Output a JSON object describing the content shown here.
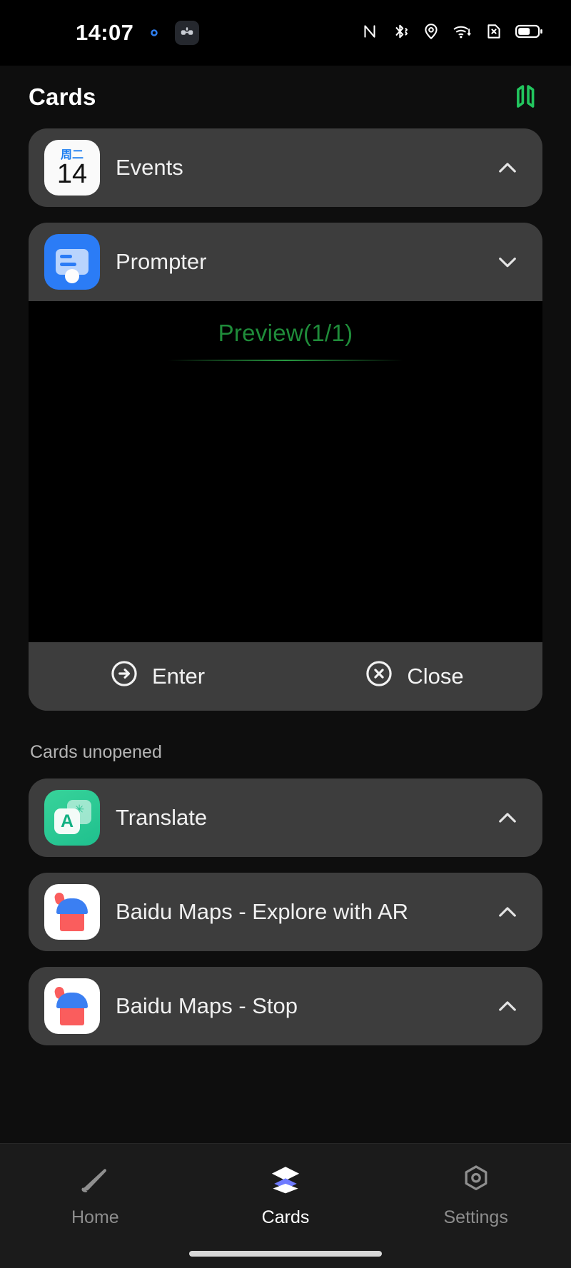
{
  "status_bar": {
    "time": "14:07",
    "left_icons": [
      "settings-gear-icon",
      "glasses-icon"
    ],
    "right_icons": [
      "nfc-icon",
      "bluetooth-icon",
      "location-icon",
      "wifi-icon",
      "no-sim-icon",
      "battery-icon"
    ],
    "battery_level_percent": 62
  },
  "header": {
    "title": "Cards",
    "action_icon": "glasses-cards-icon",
    "accent_color": "#22c55e"
  },
  "cards_opened": [
    {
      "id": "events",
      "label": "Events",
      "icon": "calendar-icon",
      "calendar_weekday": "周二",
      "calendar_day": "14",
      "expanded": false,
      "chevron": "chevron-up-icon"
    },
    {
      "id": "prompter",
      "label": "Prompter",
      "icon": "prompter-icon",
      "expanded": true,
      "chevron": "chevron-down-icon",
      "preview": {
        "title": "Preview(1/1)",
        "text_color": "#1f8c3a",
        "background": "#000000"
      },
      "actions": [
        {
          "label": "Enter",
          "icon": "arrow-right-circle-icon"
        },
        {
          "label": "Close",
          "icon": "close-circle-icon"
        }
      ]
    }
  ],
  "section": {
    "unopened_label": "Cards unopened"
  },
  "cards_unopened": [
    {
      "id": "translate",
      "label": "Translate",
      "icon": "translate-icon",
      "icon_letter": "A",
      "chevron": "chevron-up-icon"
    },
    {
      "id": "baidu-maps-ar",
      "label": "Baidu Maps - Explore with AR",
      "icon": "baidu-maps-icon",
      "chevron": "chevron-up-icon"
    },
    {
      "id": "baidu-maps-stop",
      "label": "Baidu Maps - Stop",
      "icon": "baidu-maps-icon",
      "chevron": "chevron-up-icon"
    }
  ],
  "bottom_nav": {
    "items": [
      {
        "id": "home",
        "label": "Home",
        "icon": "home-arrow-icon",
        "active": false
      },
      {
        "id": "cards",
        "label": "Cards",
        "icon": "cards-stack-icon",
        "active": true
      },
      {
        "id": "settings",
        "label": "Settings",
        "icon": "settings-hex-icon",
        "active": false
      }
    ]
  }
}
